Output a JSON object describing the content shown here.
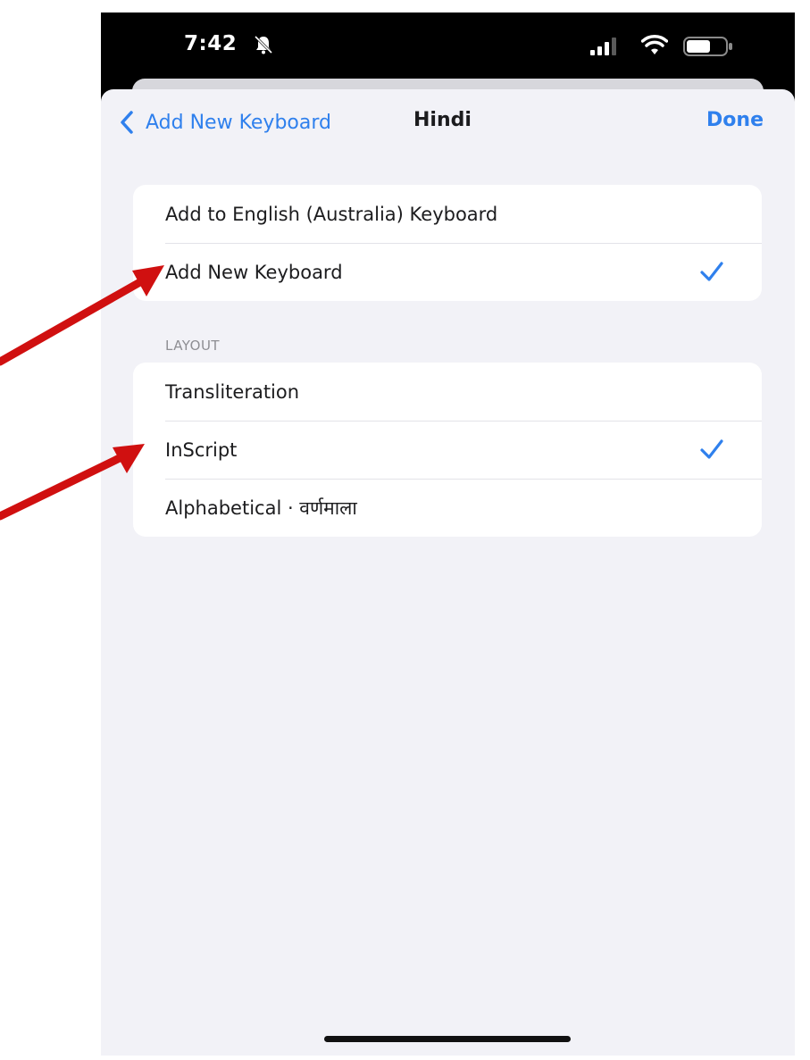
{
  "status_bar": {
    "time": "7:42",
    "icons": [
      "bell-slash-icon",
      "signal-icon",
      "wifi-icon",
      "battery-icon"
    ]
  },
  "nav": {
    "back_label": "Add New Keyboard",
    "title": "Hindi",
    "done_label": "Done"
  },
  "keyboard_options": {
    "items": [
      {
        "label": "Add to English (Australia) Keyboard",
        "checked": false
      },
      {
        "label": "Add New Keyboard",
        "checked": true
      }
    ]
  },
  "layout": {
    "header": "LAYOUT",
    "items": [
      {
        "label": "Transliteration",
        "checked": false
      },
      {
        "label": "InScript",
        "checked": true
      },
      {
        "label": "Alphabetical · वर्णमाला",
        "checked": false
      }
    ]
  },
  "colors": {
    "accent": "#2f80ed",
    "annotation_arrow": "#d01010",
    "background": "#f2f2f7"
  }
}
